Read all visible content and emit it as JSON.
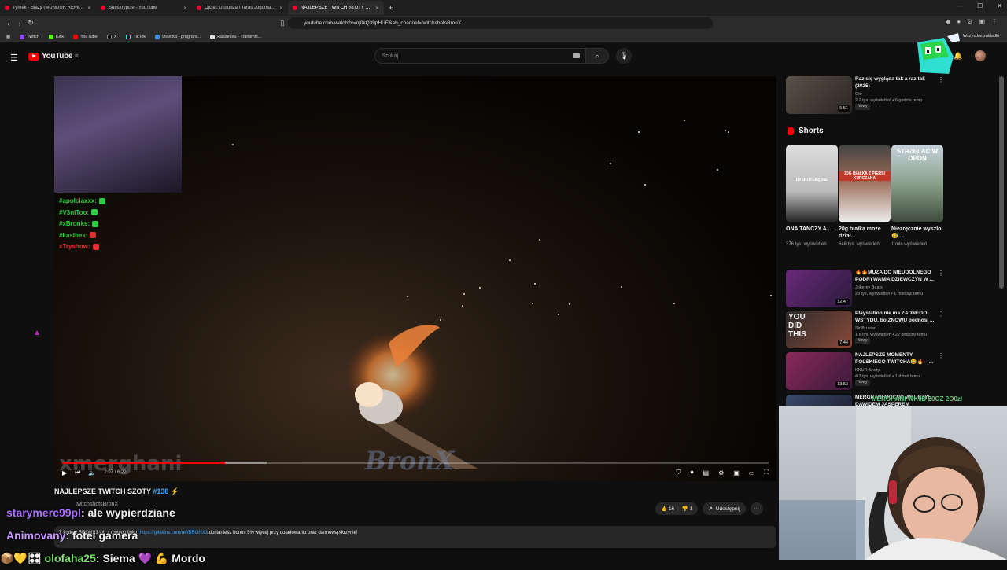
{
  "browser": {
    "tabs": [
      {
        "label": "Tymek - Blazy (MUNDUR REMIX) - Y",
        "active": false
      },
      {
        "label": "Subskrypcje - YouTube",
        "active": false
      },
      {
        "label": "Ojciec Ufoludża i Taras Jogomajstr...",
        "active": false
      },
      {
        "label": "NAJLEPSZE TWITCH SZOTY #138",
        "active": true
      }
    ],
    "url": "youtube.com/watch?v=oj0kQ39pHUE&ab_channel=twitchshotsBronX",
    "bookmarks": [
      "Twitch",
      "Kick",
      "YouTube",
      "X",
      "TikTok",
      "Usterka - program...",
      "Raszei.eu - Transmis..."
    ],
    "bookmarks_right": "Wszystkie zakładki"
  },
  "youtube": {
    "logo": "YouTube",
    "logo_region": "PL",
    "search_placeholder": "Szukaj"
  },
  "player": {
    "chat_overlay": [
      {
        "name": "#apolciaxxx:",
        "color": "green"
      },
      {
        "name": "#V3niToo:",
        "color": "green"
      },
      {
        "name": "#xBronks:",
        "color": "green"
      },
      {
        "name": "#kasibek:",
        "color": "green"
      },
      {
        "name": "xTryshow:",
        "color": "red"
      }
    ],
    "watermark_left": "xmerghani",
    "watermark_center": "BronX",
    "time": "2:07 / 6:22",
    "progress_played": 0.23,
    "progress_loaded": 0.29
  },
  "video": {
    "title_main": "NAJLEPSZE TWITCH SZOTY ",
    "title_tag": "#138",
    "title_emoji": "⚡",
    "channel": "twitchshotsBronX",
    "likes": "16",
    "dislikes": "1",
    "share_label": "Udostępnij",
    "description_prefix": "Z kodem BRONX3 lub z mojego linku: ",
    "description_link": "https://g4skins.com/ref/BRONX3",
    "description_suffix": " dostaniesz bonus 5% więcej przy doładowaniu oraz darmową skrzynie!"
  },
  "twitch_chat": [
    {
      "user": "starymerc99pl",
      "user_color": "#a970ff",
      "msg": ": ale wypierdziane"
    },
    {
      "user": "Animovany",
      "user_color": "#c79bff",
      "msg": ": fotel gamera"
    },
    {
      "user": "olofaha25",
      "user_color": "#7ee36f",
      "msg": ": Siema 💜 💪 Mordo",
      "badges": "📦💛🎛"
    }
  ],
  "sidebar": {
    "top_video": {
      "title": "Raz się wygląda tak a raz tak (2025)",
      "channel": "Olo",
      "meta": "2,2 tys. wyświetleń • 6 godzin temu",
      "badge": "Nowy",
      "duration": "5:51"
    },
    "shorts_title": "Shorts",
    "shorts": [
      {
        "title": "ONA TAŃCZY A ...",
        "views": "376 tys. wyświetleń",
        "overlay": "DYSKOTEKĘ NIE"
      },
      {
        "title": "20g białka może dział...",
        "views": "646 tys. wyświetleń",
        "overlay": "20G BIAŁKA Z PIERSI KURCZAKA"
      },
      {
        "title": "Niezręcznie wyszlo 😅 ...",
        "views": "1 mln wyświetleń",
        "overlay": "STRZELAC W OPON"
      }
    ],
    "videos": [
      {
        "title": "🔥🔥MUZA DO NIEUDOLNEGO PODRYWANIA DZIEWCZYN W ...",
        "channel": "Jokerey Beats",
        "meta": "28 tys. wyświetleń • 1 miesiąc temu",
        "duration": "12:47",
        "badge": ""
      },
      {
        "title": "Playstation nie ma ŻADNEGO WSTYDU, bo ZNOWU podnosi ...",
        "channel": "Sir Bruvian",
        "meta": "1,6 tys. wyświetleń • 22 godziny temu",
        "duration": "7:44",
        "badge": "Nowy",
        "thumb_text": "YOU DID THIS"
      },
      {
        "title": "NAJLEPSZE MOMENTY POLSKIEGO TWITCHA😂🔥 – ...",
        "channel": "KNUR Shoty",
        "meta": "4,3 tys. wyświetleń • 1 dzień temu",
        "duration": "13:53",
        "badge": "Nowy"
      },
      {
        "title": "MERGHANI MOCNO WKURZYŁ DAWIDEM JASPEREM",
        "channel": "",
        "meta": "",
        "duration": "",
        "badge": ""
      }
    ]
  },
  "stream_overlay_text": "MERGHANI WK0D 20OZ 2O0zl"
}
